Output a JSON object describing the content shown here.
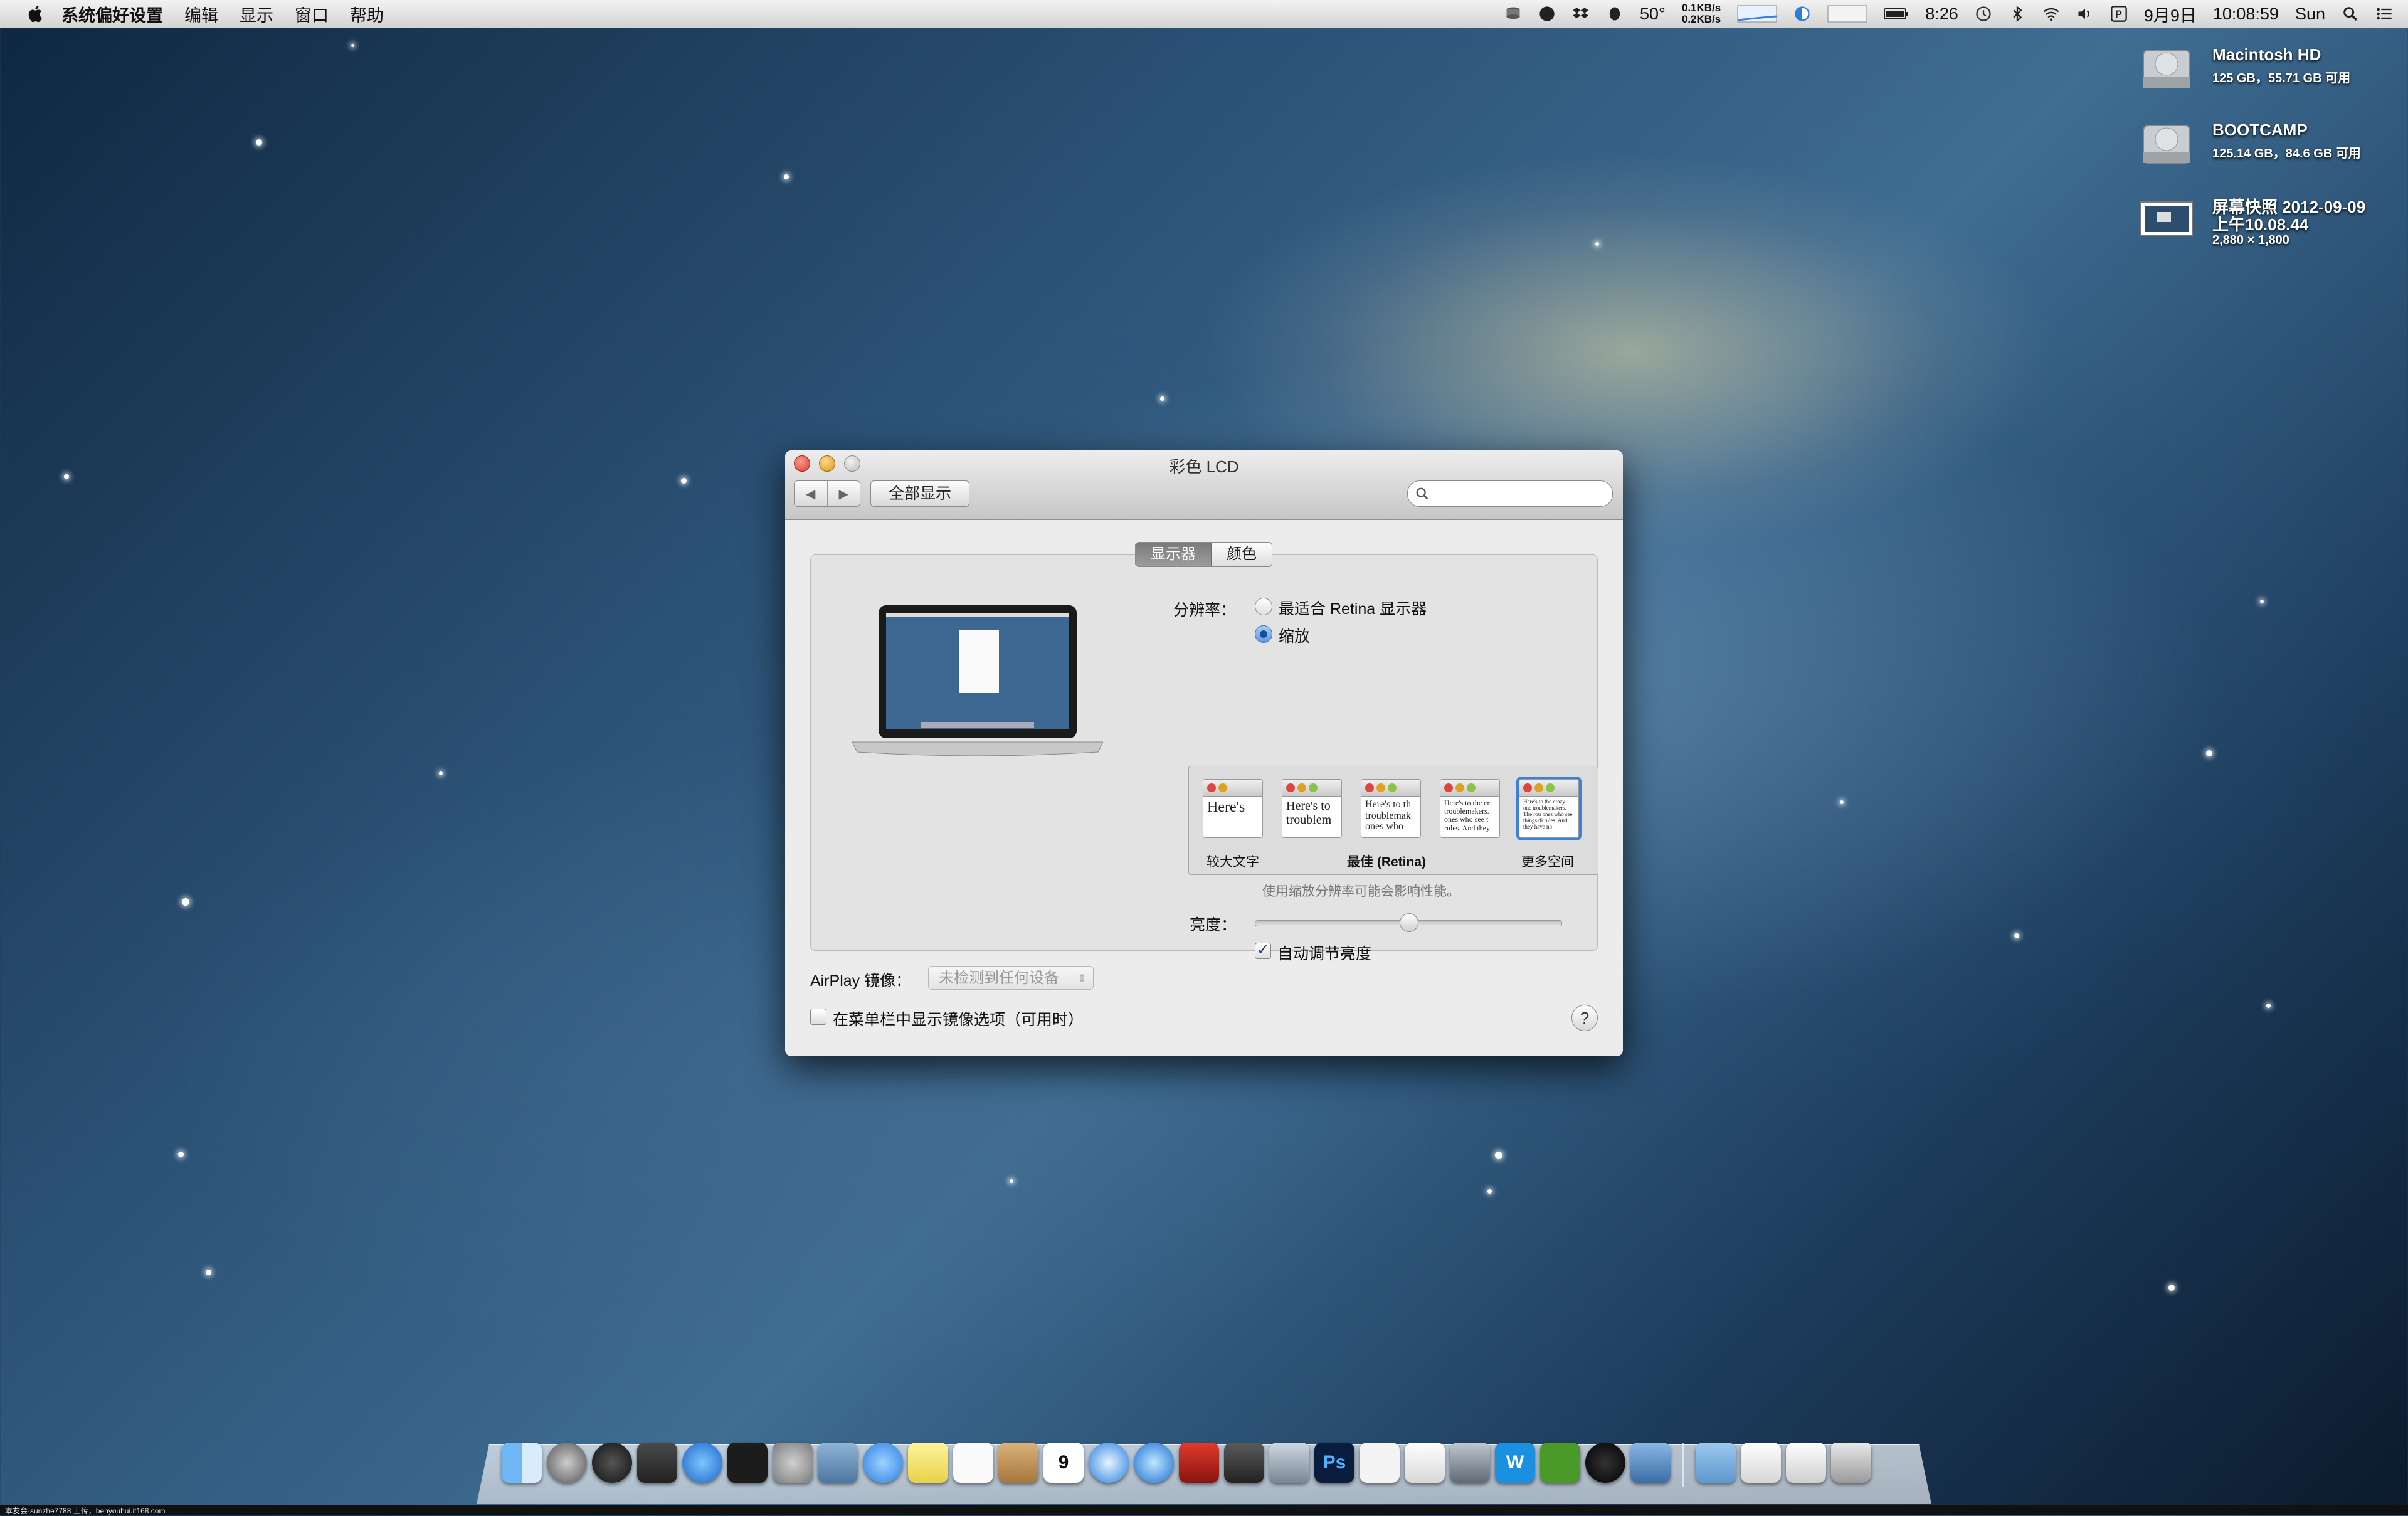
{
  "menubar": {
    "app_name": "系统偏好设置",
    "items": [
      "编辑",
      "显示",
      "窗口",
      "帮助"
    ],
    "temperature": "50°",
    "net_up": "0.1KB/s",
    "net_down": "0.2KB/s",
    "battery_time": "8:26",
    "date": "9月9日",
    "time": "10:08:59",
    "day": "Sun"
  },
  "desktop": {
    "icons": [
      {
        "name": "Macintosh HD",
        "sub": "125 GB，55.71 GB 可用"
      },
      {
        "name": "BOOTCAMP",
        "sub": "125.14 GB，84.6 GB 可用"
      },
      {
        "name": "屏幕快照 2012-09-09",
        "name2": "上午10.08.44",
        "sub": "2,880 × 1,800"
      }
    ]
  },
  "window": {
    "title": "彩色 LCD",
    "show_all": "全部显示",
    "search_placeholder": "",
    "tabs": [
      "显示器",
      "颜色"
    ],
    "resolution_label": "分辨率：",
    "resolution_options": [
      "最适合 Retina 显示器",
      "缩放"
    ],
    "resolution_selected": 1,
    "scale_options": [
      {
        "sample": "Here's",
        "label": "较大文字"
      },
      {
        "sample": "Here's to troublem",
        "label": ""
      },
      {
        "sample": "Here's to th troublemak ones who",
        "label": "最佳 (Retina)"
      },
      {
        "sample": "Here's to the cr troublemakers. ones who see t rules. And they",
        "label": ""
      },
      {
        "sample": "Here's to the crazy one troublemakers. The rou ones who see things di rules. And they have no",
        "label": "更多空间"
      }
    ],
    "scale_selected": 4,
    "scale_note": "使用缩放分辨率可能会影响性能。",
    "brightness_label": "亮度：",
    "brightness_level": 0.5,
    "auto_brightness_label": "自动调节亮度",
    "auto_brightness_checked": true,
    "airplay_label": "AirPlay 镜像：",
    "airplay_value": "未检测到任何设备",
    "mirror_menu_label": "在菜单栏中显示镜像选项（可用时）",
    "help": "?"
  },
  "dock": {
    "icons": [
      "finder-icon",
      "launchpad-icon",
      "dashboard-icon",
      "mission-control-icon",
      "app-store-icon",
      "activity-monitor-icon",
      "system-preferences-icon",
      "preview-icon",
      "messages-icon",
      "stickies-icon",
      "reminders-icon",
      "contacts-icon",
      "calendar-icon",
      "safari-icon",
      "itunes-icon",
      "photo-booth-icon",
      "iphoto-icon",
      "image-capture-icon",
      "photoshop-icon",
      "acrobat-icon",
      "textedit-icon",
      "script-icon",
      "word-icon",
      "evernote-icon",
      "qq-icon",
      "xcode-icon",
      "folder-icon",
      "document-icon",
      "downloads-icon",
      "trash-icon"
    ],
    "calendar_day": "9",
    "ps_label": "Ps",
    "word_label": "W"
  },
  "footer": "本友会·sunzhe7788 上传，benyouhui.it168.com",
  "colors": {
    "accent": "#3b82d6",
    "close": "#e0443e",
    "minimize": "#dea123"
  }
}
